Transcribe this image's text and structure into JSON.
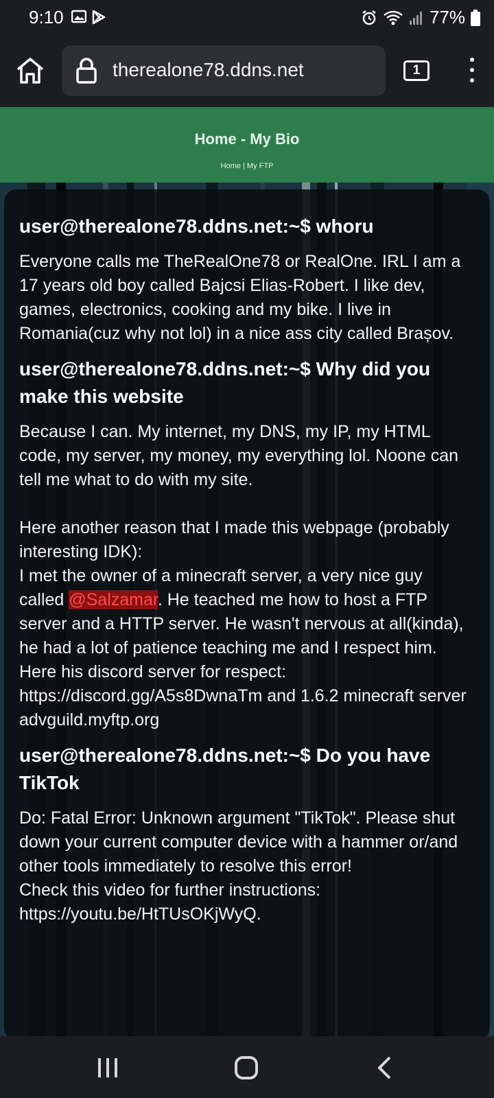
{
  "status_bar": {
    "time": "9:10",
    "battery": "77%",
    "icons": [
      "image-icon",
      "play-store-icon",
      "alarm-icon",
      "wifi-icon",
      "signal-icon",
      "battery-icon"
    ]
  },
  "browser": {
    "url": "therealone78.ddns.net",
    "tab_count": "1"
  },
  "header": {
    "title": "Home - My Bio",
    "nav_home": "Home",
    "nav_separator": " | ",
    "nav_ftp": "My FTP",
    "color": "#2e7d4c"
  },
  "content": {
    "h1": "user@therealone78.ddns.net:~$ whoru",
    "p1": "Everyone calls me TheRealOne78 or RealOne. IRL I am a 17 years old boy called Bajcsi Elias-Robert. I like dev, games, electronics, cooking and my bike. I live in Romania(cuz why not lol) in a nice ass city called Brașov.",
    "h2": "user@therealone78.ddns.net:~$ Why did you make this website",
    "p2": "Because I can. My internet, my DNS, my IP, my HTML code, my server, my money, my everything lol. Noone can tell me what to do with my site.",
    "p3a": "Here another reason that I made this webpage (probably interesting IDK):",
    "p3b_before": "I met the owner of a minecraft server, a very nice guy called ",
    "mention": "@Salzamar",
    "p3b_after": ". He teached me how to host a FTP server and a HTTP server. He wasn't nervous at all(kinda), he had a lot of patience teaching me and I respect him.",
    "p3c": "Here his discord server for respect: https://discord.gg/A5s8DwnaTm and 1.6.2 minecraft server advguild.myftp.org",
    "h3": "user@therealone78.ddns.net:~$ Do you have TikTok",
    "p4a": "Do: Fatal Error: Unknown argument \"TikTok\". Please shut down your current computer device with a hammer or/and other tools immediately to resolve this error!",
    "p4b": "Check this video for further instructions: https://youtu.be/HtTUsOKjWyQ."
  },
  "nav_bar": {
    "icons": [
      "recent-apps-icon",
      "home-icon",
      "back-icon"
    ]
  }
}
